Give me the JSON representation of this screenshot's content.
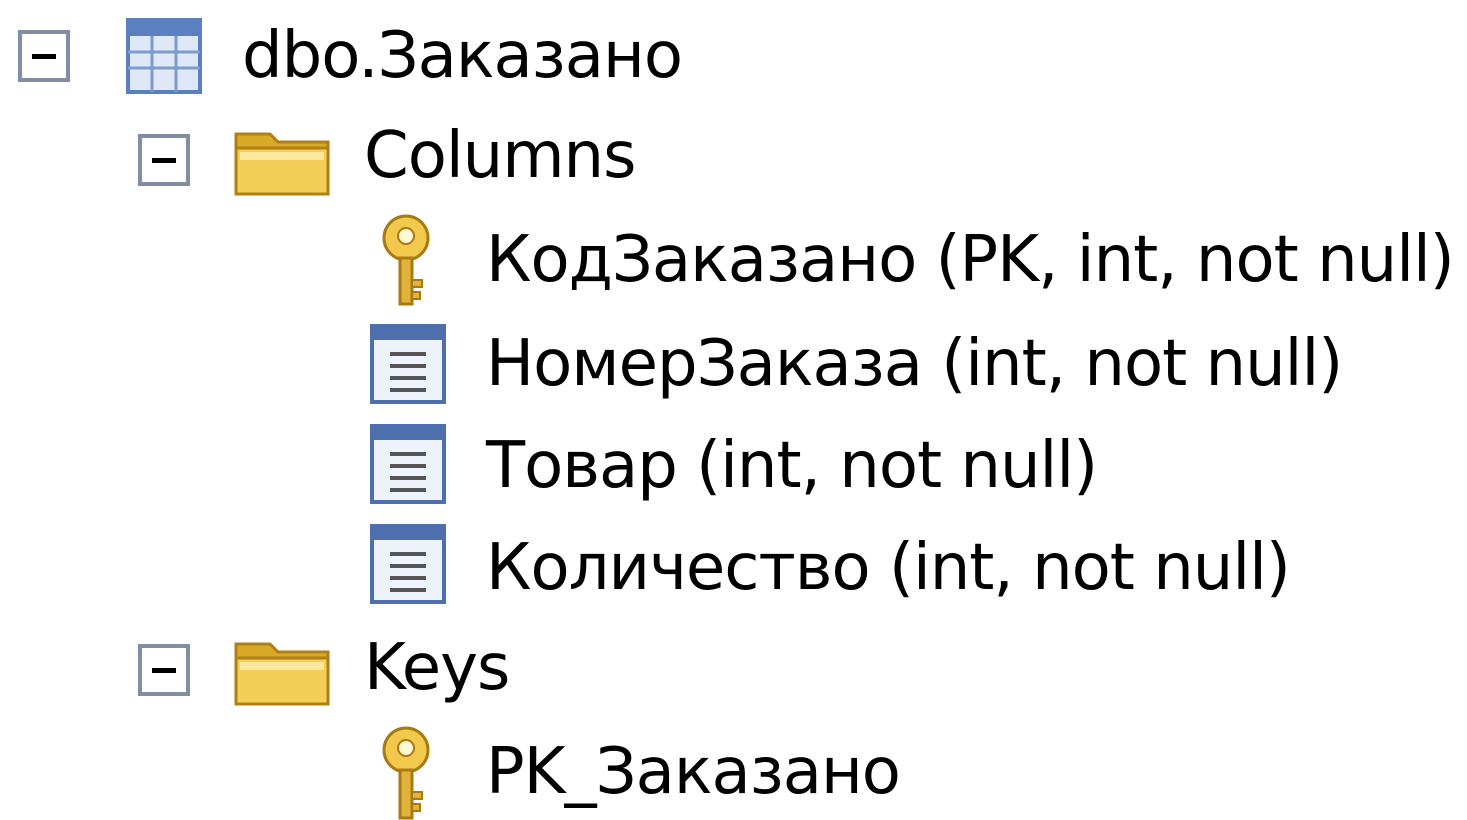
{
  "tree": {
    "table": {
      "label": "dbo.Заказано",
      "icon": "table-icon",
      "expanded": true
    },
    "columns_folder": {
      "label": "Columns",
      "icon": "folder-icon",
      "expanded": true
    },
    "columns": [
      {
        "label": "КодЗаказано (PK, int, not null)",
        "icon": "primary-key-icon"
      },
      {
        "label": "НомерЗаказа (int, not null)",
        "icon": "column-icon"
      },
      {
        "label": "Товар (int, not null)",
        "icon": "column-icon"
      },
      {
        "label": "Количество (int, not null)",
        "icon": "column-icon"
      }
    ],
    "keys_folder": {
      "label": "Keys",
      "icon": "folder-icon",
      "expanded": true
    },
    "keys": [
      {
        "label": "PK_Заказано",
        "icon": "primary-key-icon"
      }
    ]
  },
  "colors": {
    "expander_border": "#7f8ea5",
    "folder_yellow": "#f3cf5a",
    "table_blue": "#5b80c0",
    "key_gold": "#e0b43a"
  }
}
